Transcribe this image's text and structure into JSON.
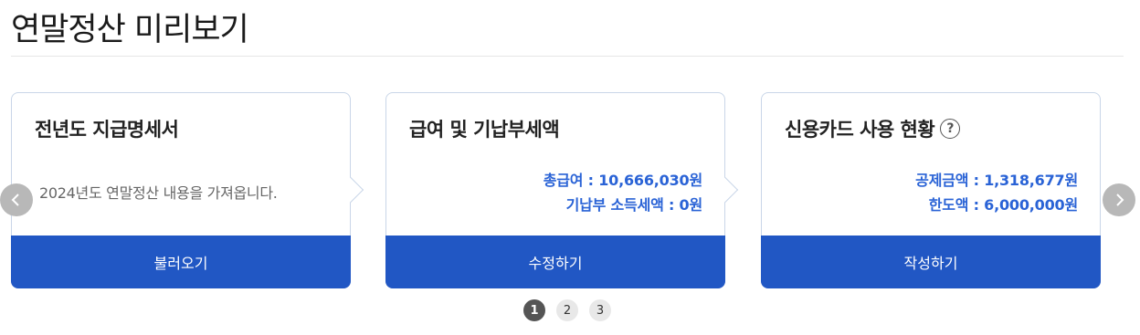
{
  "page": {
    "title": "연말정산 미리보기"
  },
  "cards": [
    {
      "title": "전년도 지급명세서",
      "description": "2024년도 연말정산 내용을 가져옵니다.",
      "button_label": "불러오기"
    },
    {
      "title": "급여 및 기납부세액",
      "lines": [
        "총급여 : 10,666,030원",
        "기납부 소득세액 : 0원"
      ],
      "button_label": "수정하기"
    },
    {
      "title": "신용카드 사용 현황",
      "help_icon": "?",
      "lines": [
        "공제금액 : 1,318,677원",
        "한도액 : 6,000,000원"
      ],
      "button_label": "작성하기"
    }
  ],
  "pagination": {
    "pages": [
      "1",
      "2",
      "3"
    ],
    "active": 1
  },
  "icons": {
    "prev": "chevron-left-icon",
    "next": "chevron-right-icon",
    "help": "question-circle-icon"
  },
  "colors": {
    "accent": "#2157c4",
    "value_text": "#2a63d6",
    "border": "#c9d6e8"
  }
}
